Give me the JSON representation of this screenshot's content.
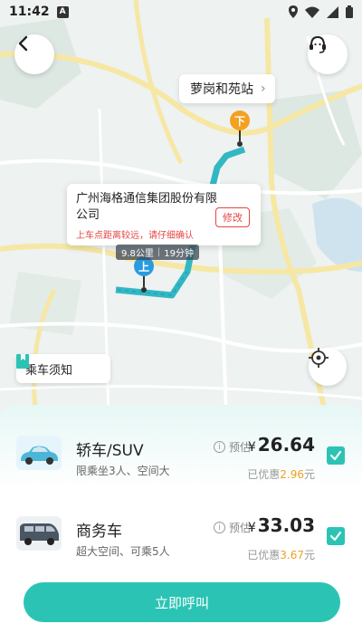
{
  "status_bar": {
    "time": "11:42",
    "notif_letter": "A"
  },
  "map": {
    "destination_name": "萝岗和苑站",
    "dropoff_marker": "下",
    "pickup_marker": "上",
    "pickup_card": {
      "address": "广州海格通信集团股份有限公司",
      "warning": "上车点距离较远，请仔细确认",
      "edit_label": "修改"
    },
    "route_info": {
      "distance": "9.8公里",
      "duration": "19分钟"
    },
    "notice_label": "乘车须知"
  },
  "cars": [
    {
      "name": "轿车/SUV",
      "desc": "限乘坐3人、空间大",
      "estimate_label": "预估",
      "currency": "¥",
      "price": "26.64",
      "discount_prefix": "已优惠",
      "discount": "2.96",
      "discount_suffix": "元",
      "selected": true
    },
    {
      "name": "商务车",
      "desc": "超大空间、可乘5人",
      "estimate_label": "预估",
      "currency": "¥",
      "price": "33.03",
      "discount_prefix": "已优惠",
      "discount": "3.67",
      "discount_suffix": "元",
      "selected": true
    }
  ],
  "call_button_label": "立即呼叫",
  "colors": {
    "accent": "#2bc4b4",
    "warning": "#e64545",
    "discount": "#f0a020",
    "marker_dropoff": "#f5a020",
    "marker_pickup": "#2a9be0"
  }
}
